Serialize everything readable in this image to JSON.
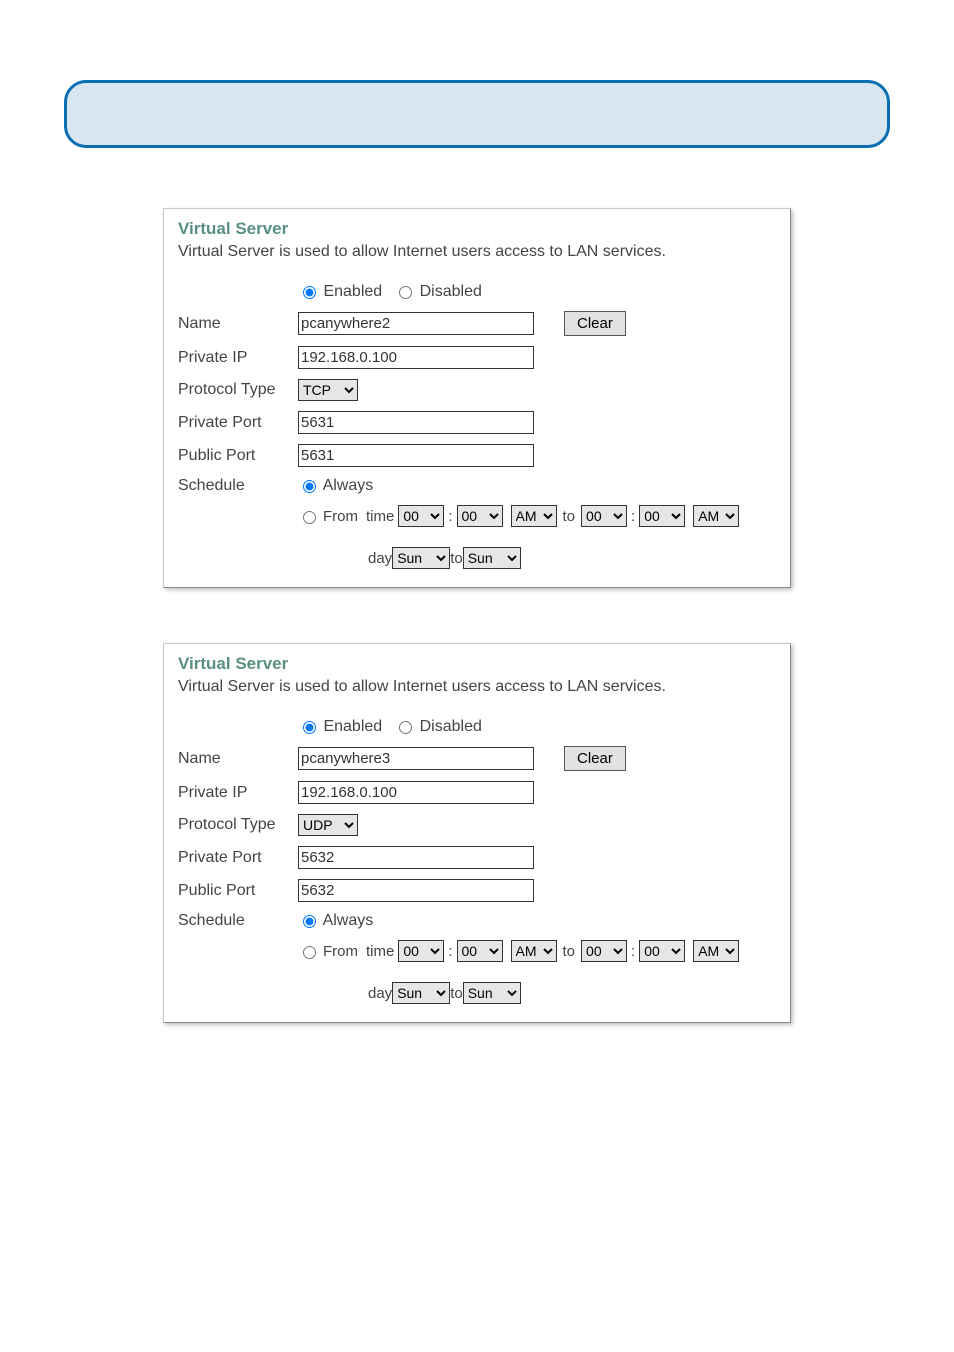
{
  "panels": [
    {
      "title": "Virtual Server",
      "desc": "Virtual Server is used to allow Internet users access to LAN services.",
      "enabled_label": "Enabled",
      "disabled_label": "Disabled",
      "name_label": "Name",
      "name_value": "pcanywhere2",
      "clear_label": "Clear",
      "privateip_label": "Private IP",
      "privateip_value": "192.168.0.100",
      "protocol_label": "Protocol Type",
      "protocol_value": "TCP",
      "privateport_label": "Private Port",
      "privateport_value": "5631",
      "publicport_label": "Public Port",
      "publicport_value": "5631",
      "schedule_label": "Schedule",
      "always_label": "Always",
      "from_label": "From",
      "time_label": "time",
      "to_label": "to",
      "day_label": "day",
      "hh1": "00",
      "mm1": "00",
      "ap1": "AM",
      "hh2": "00",
      "mm2": "00",
      "ap2": "AM",
      "day1": "Sun",
      "day2": "Sun"
    },
    {
      "title": "Virtual Server",
      "desc": "Virtual Server is used to allow Internet users access to LAN services.",
      "enabled_label": "Enabled",
      "disabled_label": "Disabled",
      "name_label": "Name",
      "name_value": "pcanywhere3",
      "clear_label": "Clear",
      "privateip_label": "Private IP",
      "privateip_value": "192.168.0.100",
      "protocol_label": "Protocol Type",
      "protocol_value": "UDP",
      "privateport_label": "Private Port",
      "privateport_value": "5632",
      "publicport_label": "Public Port",
      "publicport_value": "5632",
      "schedule_label": "Schedule",
      "always_label": "Always",
      "from_label": "From",
      "time_label": "time",
      "to_label": "to",
      "day_label": "day",
      "hh1": "00",
      "mm1": "00",
      "ap1": "AM",
      "hh2": "00",
      "mm2": "00",
      "ap2": "AM",
      "day1": "Sun",
      "day2": "Sun"
    }
  ]
}
